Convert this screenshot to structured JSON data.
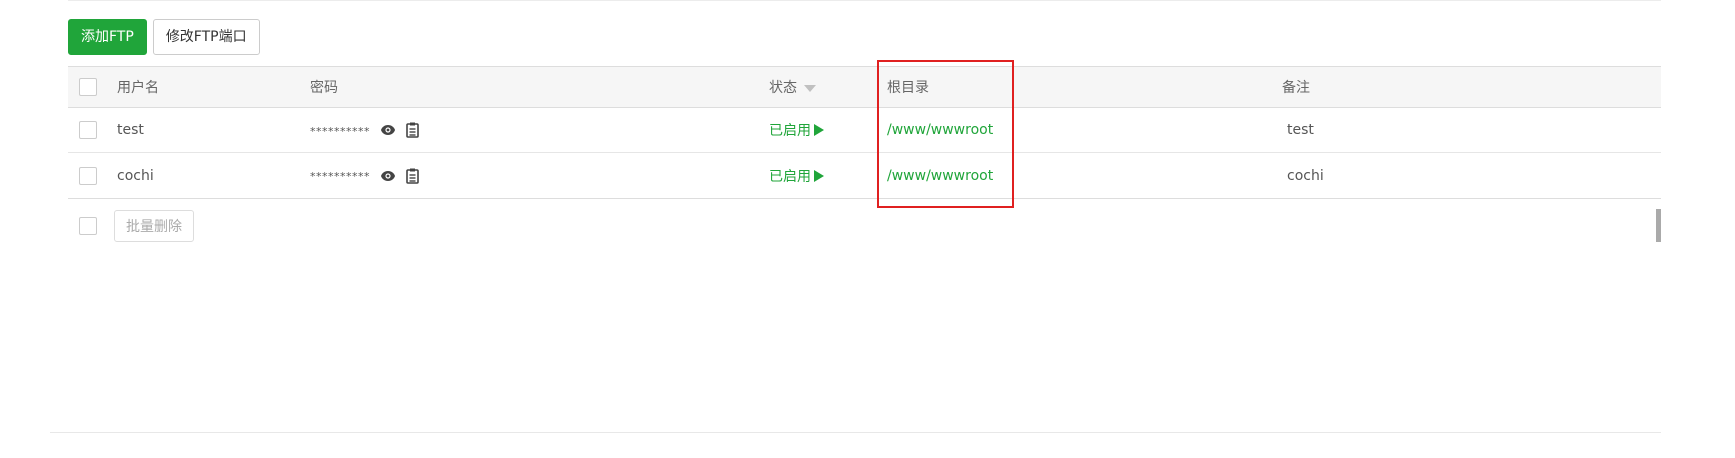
{
  "toolbar": {
    "add_label": "添加FTP",
    "modify_port_label": "修改FTP端口"
  },
  "table": {
    "headers": {
      "username": "用户名",
      "password": "密码",
      "status": "状态",
      "root": "根目录",
      "note": "备注"
    },
    "rows": [
      {
        "username": "test",
        "password": "**********",
        "status": "已启用",
        "root": "/www/wwwroot",
        "note": "test"
      },
      {
        "username": "cochi",
        "password": "**********",
        "status": "已启用",
        "root": "/www/wwwroot",
        "note": "cochi"
      }
    ]
  },
  "bulk": {
    "delete_label": "批量删除"
  },
  "icons": {
    "show_password": "eye-icon",
    "copy_password": "copy-icon",
    "status_indicator": "play-icon",
    "sort": "sort-caret-icon"
  },
  "colors": {
    "accent": "#20a53a",
    "highlight": "#e02020"
  }
}
